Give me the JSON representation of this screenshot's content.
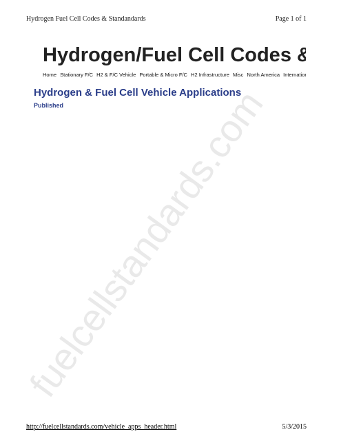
{
  "print_header": {
    "document_title": "Hydrogen Fuel Cell Codes & Standandards",
    "page_indicator": "Page 1 of 1"
  },
  "site": {
    "title": "Hydrogen/Fuel Cell Codes & Standards"
  },
  "nav": {
    "items": [
      "Home",
      "Stationary F/C",
      "H2 & F/C Vehicle",
      "Portable & Micro F/C",
      "H2 Infrastructure",
      "Misc",
      "North America",
      "International"
    ]
  },
  "main": {
    "heading": "Hydrogen & Fuel Cell Vehicle Applications",
    "status": "Published"
  },
  "watermark": {
    "text": "fuelcellstandards.com"
  },
  "print_footer": {
    "url": "http://fuelcellstandards.com/vehicle_apps_header.html",
    "date": "5/3/2015"
  }
}
